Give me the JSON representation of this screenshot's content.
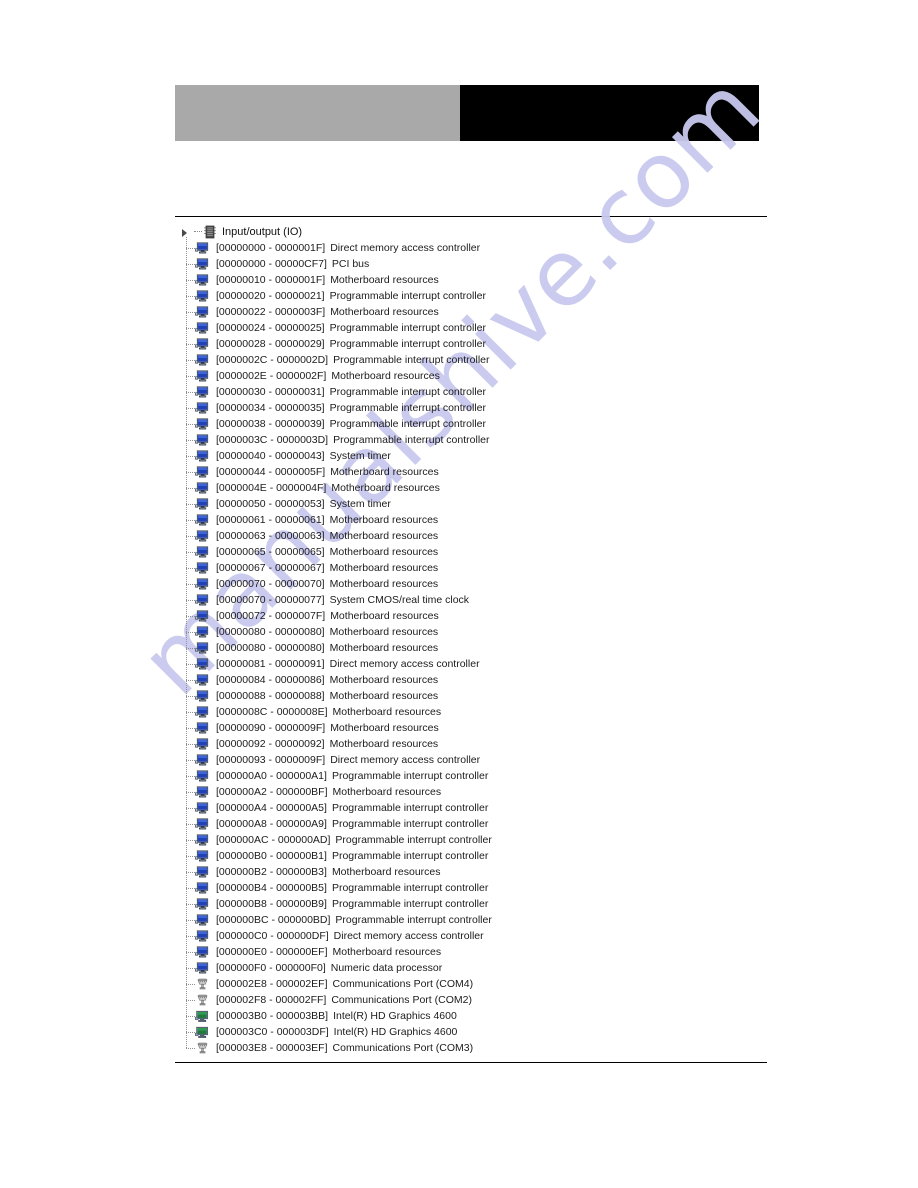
{
  "header": {
    "gray_bar_color": "#a9a9a9",
    "black_bar_color": "#000000"
  },
  "watermark": {
    "text": "manualshive.com",
    "color": "#c9c9ef"
  },
  "tree": {
    "root_label": "Input/output (IO)",
    "root_icon": "computer-chip-icon",
    "rows": [
      {
        "range": "[00000000 - 0000001F]",
        "desc": "Direct memory access controller",
        "icon": "monitor-blue-icon"
      },
      {
        "range": "[00000000 - 00000CF7]",
        "desc": "PCI bus",
        "icon": "monitor-blue-icon"
      },
      {
        "range": "[00000010 - 0000001F]",
        "desc": "Motherboard resources",
        "icon": "monitor-blue-icon"
      },
      {
        "range": "[00000020 - 00000021]",
        "desc": "Programmable interrupt controller",
        "icon": "monitor-blue-icon"
      },
      {
        "range": "[00000022 - 0000003F]",
        "desc": "Motherboard resources",
        "icon": "monitor-blue-icon"
      },
      {
        "range": "[00000024 - 00000025]",
        "desc": "Programmable interrupt controller",
        "icon": "monitor-blue-icon"
      },
      {
        "range": "[00000028 - 00000029]",
        "desc": "Programmable interrupt controller",
        "icon": "monitor-blue-icon"
      },
      {
        "range": "[0000002C - 0000002D]",
        "desc": "Programmable interrupt controller",
        "icon": "monitor-blue-icon"
      },
      {
        "range": "[0000002E - 0000002F]",
        "desc": "Motherboard resources",
        "icon": "monitor-blue-icon"
      },
      {
        "range": "[00000030 - 00000031]",
        "desc": "Programmable interrupt controller",
        "icon": "monitor-blue-icon"
      },
      {
        "range": "[00000034 - 00000035]",
        "desc": "Programmable interrupt controller",
        "icon": "monitor-blue-icon"
      },
      {
        "range": "[00000038 - 00000039]",
        "desc": "Programmable interrupt controller",
        "icon": "monitor-blue-icon"
      },
      {
        "range": "[0000003C - 0000003D]",
        "desc": "Programmable interrupt controller",
        "icon": "monitor-blue-icon"
      },
      {
        "range": "[00000040 - 00000043]",
        "desc": "System timer",
        "icon": "monitor-blue-icon"
      },
      {
        "range": "[00000044 - 0000005F]",
        "desc": "Motherboard resources",
        "icon": "monitor-blue-icon"
      },
      {
        "range": "[0000004E - 0000004F]",
        "desc": "Motherboard resources",
        "icon": "monitor-blue-icon"
      },
      {
        "range": "[00000050 - 00000053]",
        "desc": "System timer",
        "icon": "monitor-blue-icon"
      },
      {
        "range": "[00000061 - 00000061]",
        "desc": "Motherboard resources",
        "icon": "monitor-blue-icon"
      },
      {
        "range": "[00000063 - 00000063]",
        "desc": "Motherboard resources",
        "icon": "monitor-blue-icon"
      },
      {
        "range": "[00000065 - 00000065]",
        "desc": "Motherboard resources",
        "icon": "monitor-blue-icon"
      },
      {
        "range": "[00000067 - 00000067]",
        "desc": "Motherboard resources",
        "icon": "monitor-blue-icon"
      },
      {
        "range": "[00000070 - 00000070]",
        "desc": "Motherboard resources",
        "icon": "monitor-blue-icon"
      },
      {
        "range": "[00000070 - 00000077]",
        "desc": "System CMOS/real time clock",
        "icon": "monitor-blue-icon"
      },
      {
        "range": "[00000072 - 0000007F]",
        "desc": "Motherboard resources",
        "icon": "monitor-blue-icon"
      },
      {
        "range": "[00000080 - 00000080]",
        "desc": "Motherboard resources",
        "icon": "monitor-blue-icon"
      },
      {
        "range": "[00000080 - 00000080]",
        "desc": "Motherboard resources",
        "icon": "monitor-blue-icon"
      },
      {
        "range": "[00000081 - 00000091]",
        "desc": "Direct memory access controller",
        "icon": "monitor-blue-icon"
      },
      {
        "range": "[00000084 - 00000086]",
        "desc": "Motherboard resources",
        "icon": "monitor-blue-icon"
      },
      {
        "range": "[00000088 - 00000088]",
        "desc": "Motherboard resources",
        "icon": "monitor-blue-icon"
      },
      {
        "range": "[0000008C - 0000008E]",
        "desc": "Motherboard resources",
        "icon": "monitor-blue-icon"
      },
      {
        "range": "[00000090 - 0000009F]",
        "desc": "Motherboard resources",
        "icon": "monitor-blue-icon"
      },
      {
        "range": "[00000092 - 00000092]",
        "desc": "Motherboard resources",
        "icon": "monitor-blue-icon"
      },
      {
        "range": "[00000093 - 0000009F]",
        "desc": "Direct memory access controller",
        "icon": "monitor-blue-icon"
      },
      {
        "range": "[000000A0 - 000000A1]",
        "desc": "Programmable interrupt controller",
        "icon": "monitor-blue-icon"
      },
      {
        "range": "[000000A2 - 000000BF]",
        "desc": "Motherboard resources",
        "icon": "monitor-blue-icon"
      },
      {
        "range": "[000000A4 - 000000A5]",
        "desc": "Programmable interrupt controller",
        "icon": "monitor-blue-icon"
      },
      {
        "range": "[000000A8 - 000000A9]",
        "desc": "Programmable interrupt controller",
        "icon": "monitor-blue-icon"
      },
      {
        "range": "[000000AC - 000000AD]",
        "desc": "Programmable interrupt controller",
        "icon": "monitor-blue-icon"
      },
      {
        "range": "[000000B0 - 000000B1]",
        "desc": "Programmable interrupt controller",
        "icon": "monitor-blue-icon"
      },
      {
        "range": "[000000B2 - 000000B3]",
        "desc": "Motherboard resources",
        "icon": "monitor-blue-icon"
      },
      {
        "range": "[000000B4 - 000000B5]",
        "desc": "Programmable interrupt controller",
        "icon": "monitor-blue-icon"
      },
      {
        "range": "[000000B8 - 000000B9]",
        "desc": "Programmable interrupt controller",
        "icon": "monitor-blue-icon"
      },
      {
        "range": "[000000BC - 000000BD]",
        "desc": "Programmable interrupt controller",
        "icon": "monitor-blue-icon"
      },
      {
        "range": "[000000C0 - 000000DF]",
        "desc": "Direct memory access controller",
        "icon": "monitor-blue-icon"
      },
      {
        "range": "[000000E0 - 000000EF]",
        "desc": "Motherboard resources",
        "icon": "monitor-blue-icon"
      },
      {
        "range": "[000000F0 - 000000F0]",
        "desc": "Numeric data processor",
        "icon": "monitor-blue-icon"
      },
      {
        "range": "[000002E8 - 000002EF]",
        "desc": "Communications Port (COM4)",
        "icon": "serial-port-icon"
      },
      {
        "range": "[000002F8 - 000002FF]",
        "desc": "Communications Port (COM2)",
        "icon": "serial-port-icon"
      },
      {
        "range": "[000003B0 - 000003BB]",
        "desc": "Intel(R) HD Graphics 4600",
        "icon": "display-adapter-icon"
      },
      {
        "range": "[000003C0 - 000003DF]",
        "desc": "Intel(R) HD Graphics 4600",
        "icon": "display-adapter-icon"
      },
      {
        "range": "[000003E8 - 000003EF]",
        "desc": "Communications Port (COM3)",
        "icon": "serial-port-icon"
      }
    ]
  }
}
